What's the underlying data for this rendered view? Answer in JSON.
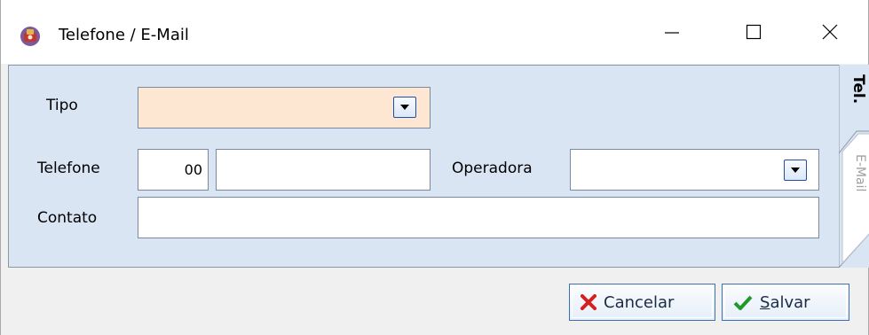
{
  "window": {
    "title": "Telefone / E-Mail",
    "app_icon": "phone-app-icon",
    "controls": {
      "minimize": "minimize-icon",
      "maximize": "maximize-icon",
      "close": "close-icon"
    }
  },
  "form": {
    "tipo": {
      "label": "Tipo",
      "value": ""
    },
    "telefone": {
      "label": "Telefone",
      "ddd": "00",
      "numero": ""
    },
    "operadora": {
      "label": "Operadora",
      "value": ""
    },
    "contato": {
      "label": "Contato",
      "value": ""
    }
  },
  "tabs": [
    {
      "label": "Tel.",
      "active": true
    },
    {
      "label": "E-Mail",
      "active": false
    }
  ],
  "buttons": {
    "cancel": {
      "label": "Cancelar",
      "icon": "x-icon",
      "color": "#d42020"
    },
    "save": {
      "label_first": "S",
      "label_rest": "alvar",
      "icon": "check-icon",
      "color": "#1f9a2a"
    }
  },
  "colors": {
    "panel": "#dae5f4",
    "tipo_field": "#fde7d3",
    "accent": "#1f4fa3"
  }
}
